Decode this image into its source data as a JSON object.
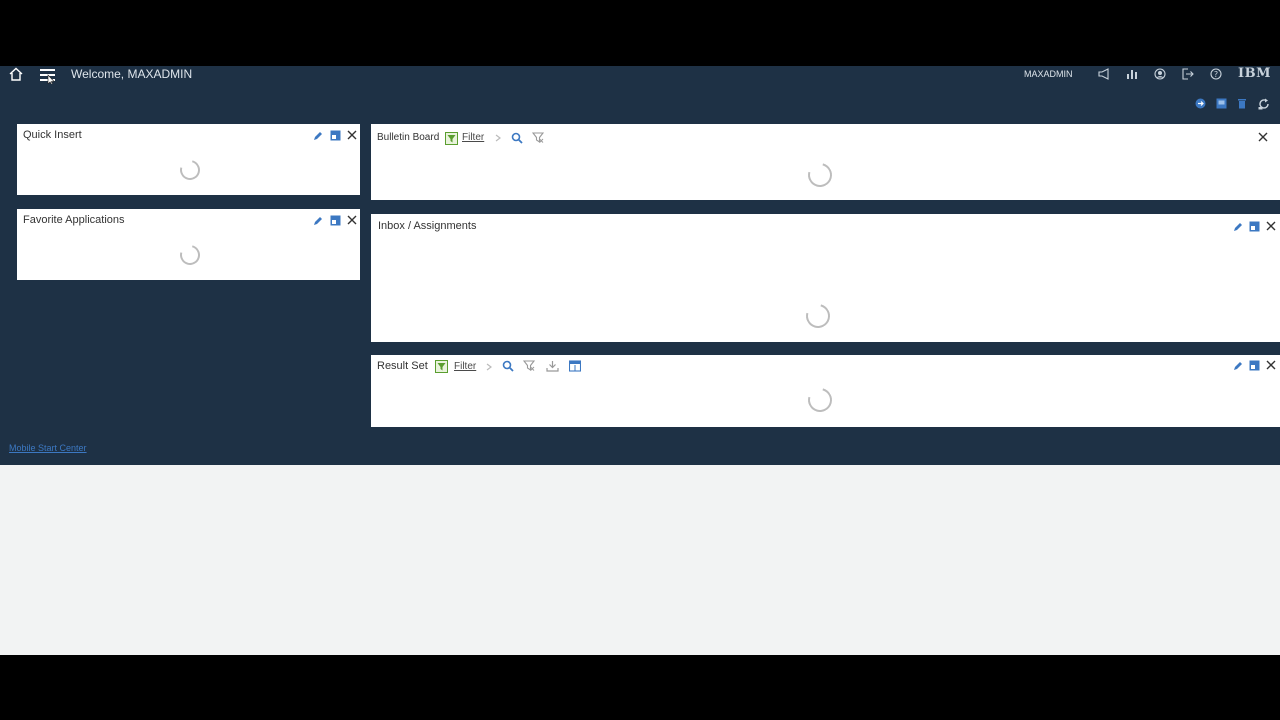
{
  "header": {
    "welcome": "Welcome, MAXADMIN",
    "user": "MAXADMIN",
    "brand": "IBM"
  },
  "panels": {
    "quick_insert": {
      "title": "Quick Insert"
    },
    "favorite_apps": {
      "title": "Favorite Applications"
    },
    "bulletin": {
      "title": "Bulletin Board",
      "filter": "Filter"
    },
    "inbox": {
      "title": "Inbox / Assignments"
    },
    "result_set": {
      "title": "Result Set",
      "filter": "Filter"
    }
  },
  "footer": {
    "mobile_link": "Mobile Start Center"
  },
  "colors": {
    "header_bg": "#1e3145",
    "accent": "#3c78c2",
    "filter_green": "#5a9e2f"
  }
}
